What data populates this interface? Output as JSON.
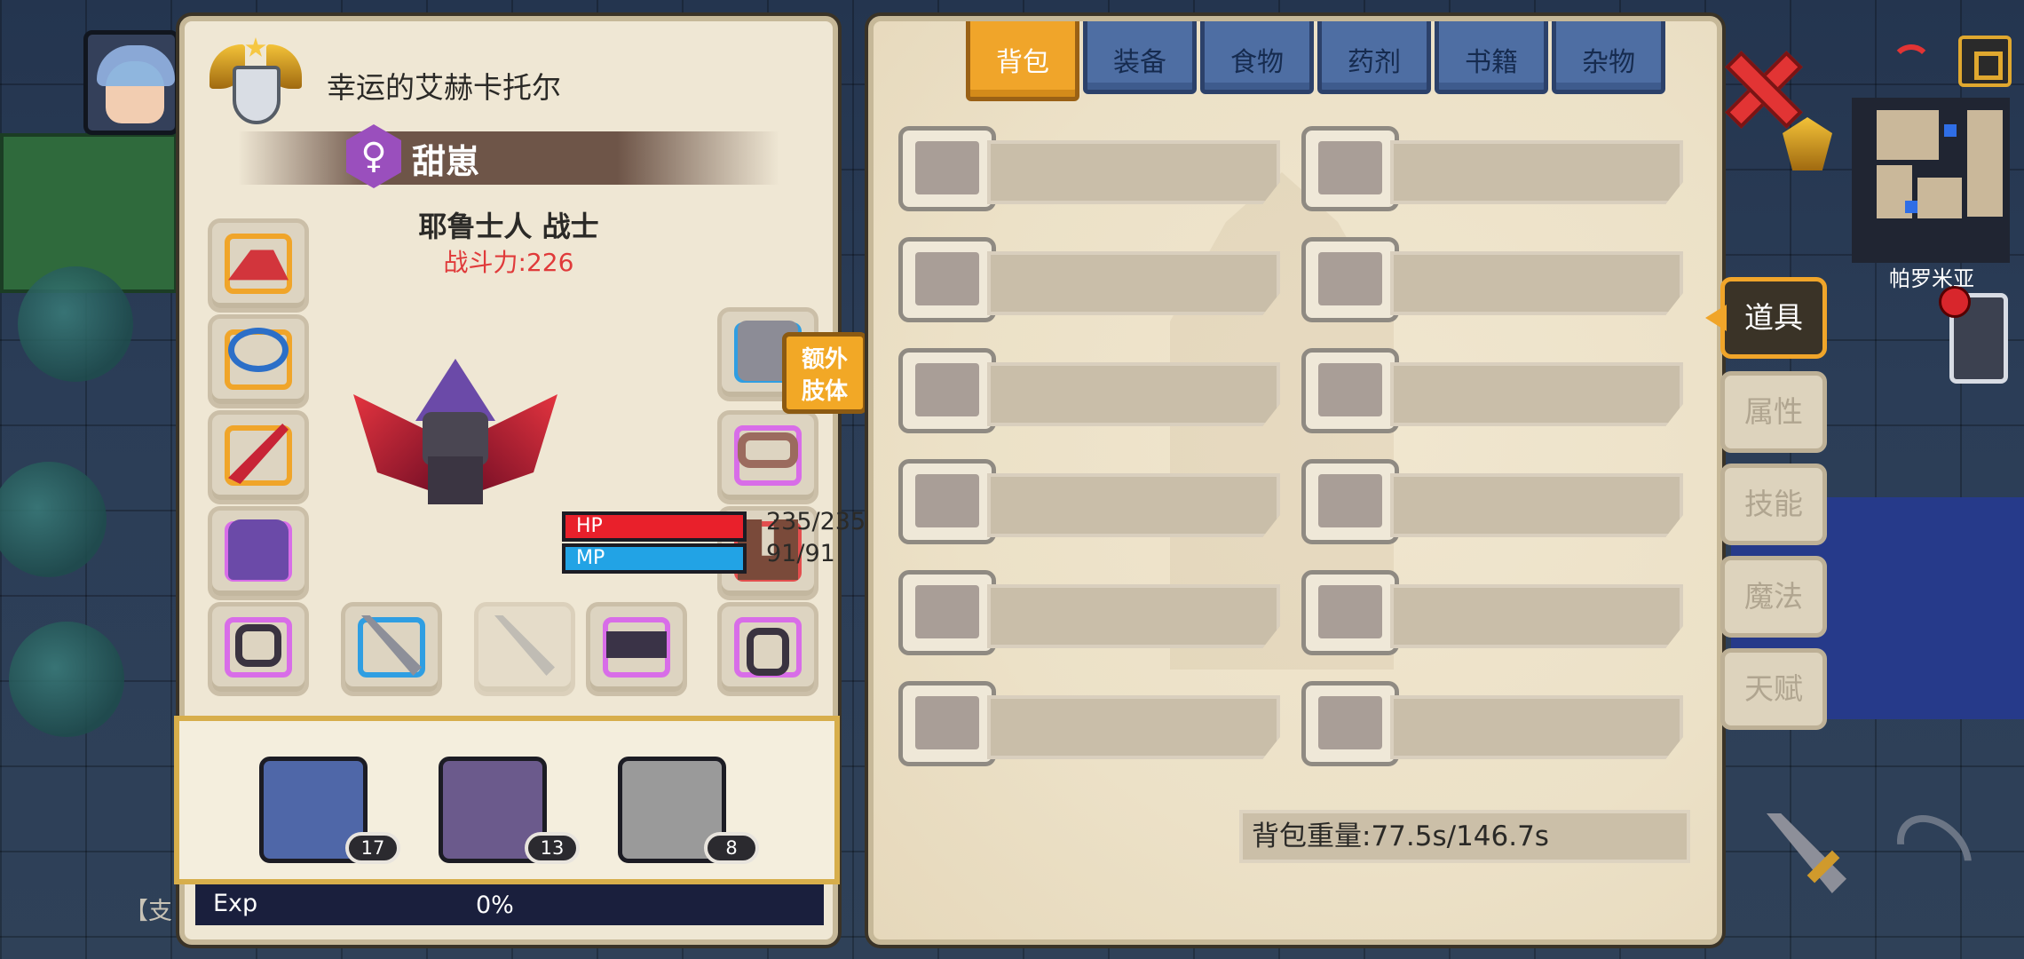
{
  "player": {
    "rank_title": "幸运的艾赫卡托尔",
    "gender_symbol": "♀",
    "name": "甜崽",
    "race_class": "耶鲁士人 战士",
    "combat_power": "战斗力:226",
    "hp_label": "HP",
    "hp_value": "235/235",
    "mp_label": "MP",
    "mp_value": "91/91",
    "extra_limb_button": "额外\n肢体",
    "exp_label": "Exp",
    "exp_value": "0%"
  },
  "party": [
    {
      "level": "17"
    },
    {
      "level": "13"
    },
    {
      "level": "8"
    }
  ],
  "inventory": {
    "tabs": [
      "背包",
      "装备",
      "食物",
      "药剂",
      "书籍",
      "杂物"
    ],
    "active_tab": "背包",
    "weight": "背包重量:77.5s/146.7s"
  },
  "side_tabs": [
    "道具",
    "属性",
    "技能",
    "魔法",
    "天赋"
  ],
  "map": {
    "location": "帕罗米亚"
  },
  "side_hint": "【支",
  "colors": {
    "accent_gold": "#f0a52a",
    "tab_blue": "#4e6ea3",
    "hp_red": "#e9202b",
    "mp_blue": "#22a3e5",
    "power_red": "#e03a3a",
    "rare_purple": "#d86de8"
  },
  "icons": {
    "close": "red-x-icon",
    "wifi": "wifi-icon",
    "exit": "exit-icon",
    "phone": "phone-icon",
    "sword": "sword-icon",
    "bow": "bow-icon"
  }
}
